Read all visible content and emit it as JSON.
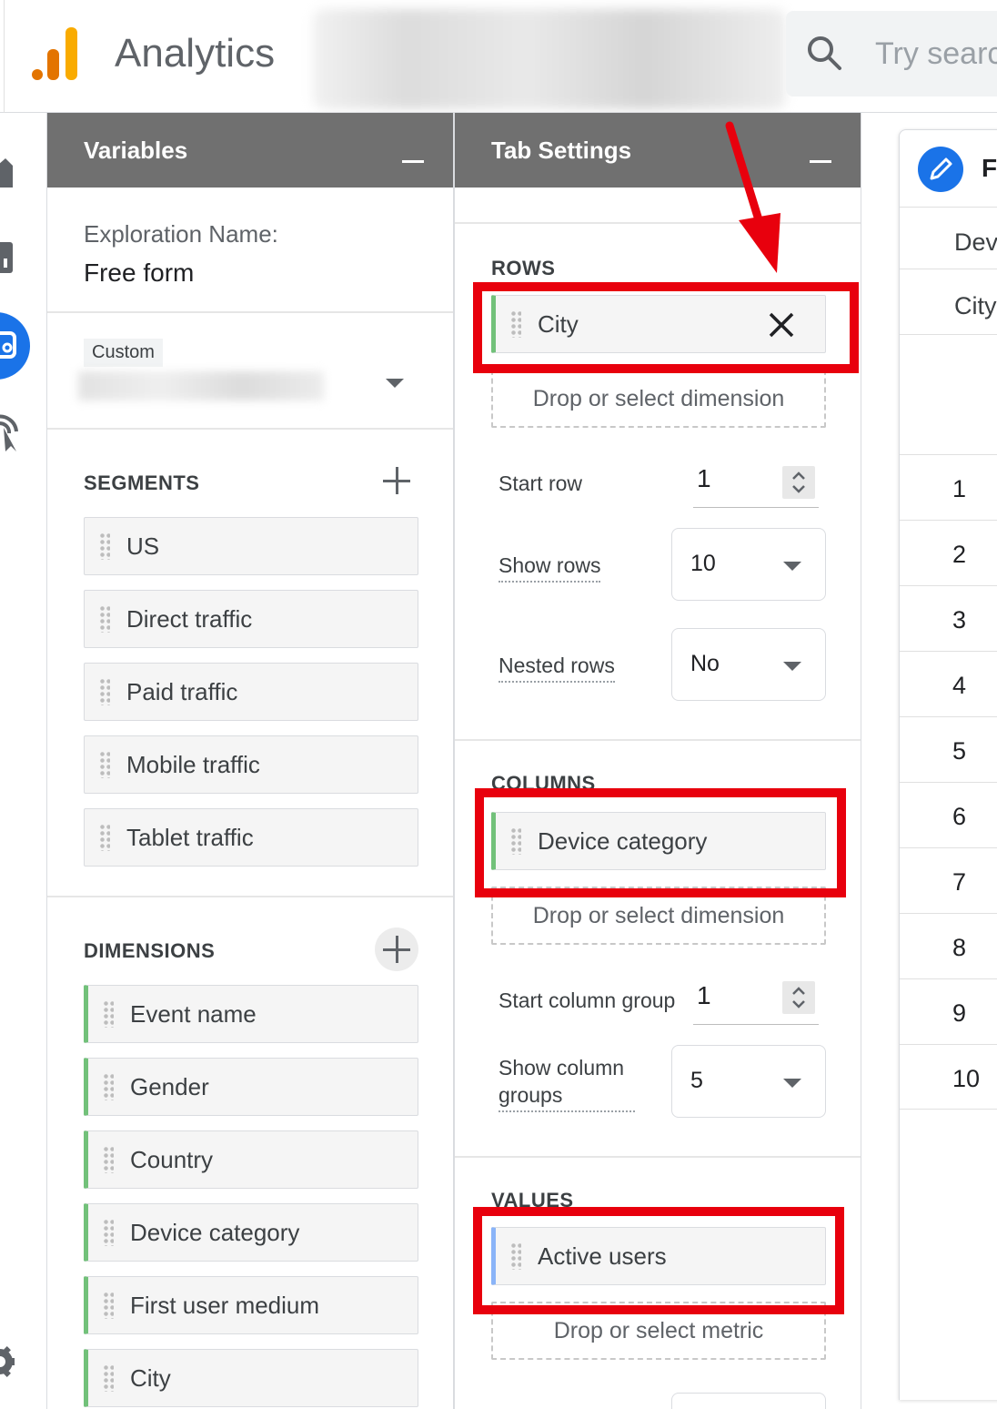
{
  "app": {
    "title": "Analytics",
    "search_placeholder": "Try search"
  },
  "colors": {
    "accent_blue": "#1a73e8",
    "highlight_red": "#e8000d",
    "dimension_green": "#72c17a",
    "metric_blue": "#8ab4f8",
    "header_gray": "#707070"
  },
  "variables_panel": {
    "title": "Variables",
    "exploration_name_label": "Exploration Name:",
    "exploration_name_value": "Free form",
    "date_badge": "Custom",
    "segments": {
      "label": "SEGMENTS",
      "items": [
        "US",
        "Direct traffic",
        "Paid traffic",
        "Mobile traffic",
        "Tablet traffic"
      ]
    },
    "dimensions": {
      "label": "DIMENSIONS",
      "items": [
        "Event name",
        "Gender",
        "Country",
        "Device category",
        "First user medium",
        "City"
      ]
    }
  },
  "tab_settings": {
    "title": "Tab Settings",
    "rows": {
      "label": "ROWS",
      "chip": "City",
      "dropzone": "Drop or select dimension",
      "start_row_label": "Start row",
      "start_row_value": "1",
      "show_rows_label": "Show rows",
      "show_rows_value": "10",
      "nested_rows_label": "Nested rows",
      "nested_rows_value": "No"
    },
    "columns": {
      "label": "COLUMNS",
      "chip": "Device category",
      "dropzone": "Drop or select dimension",
      "start_group_label": "Start column group",
      "start_group_value": "1",
      "show_groups_label": "Show column groups",
      "show_groups_value": "5"
    },
    "values": {
      "label": "VALUES",
      "chip": "Active users",
      "dropzone": "Drop or select metric"
    }
  },
  "preview": {
    "title": "Fr",
    "col_header": "Dev",
    "row_header": "City",
    "row_numbers": [
      "1",
      "2",
      "3",
      "4",
      "5",
      "6",
      "7",
      "8",
      "9",
      "10"
    ]
  }
}
